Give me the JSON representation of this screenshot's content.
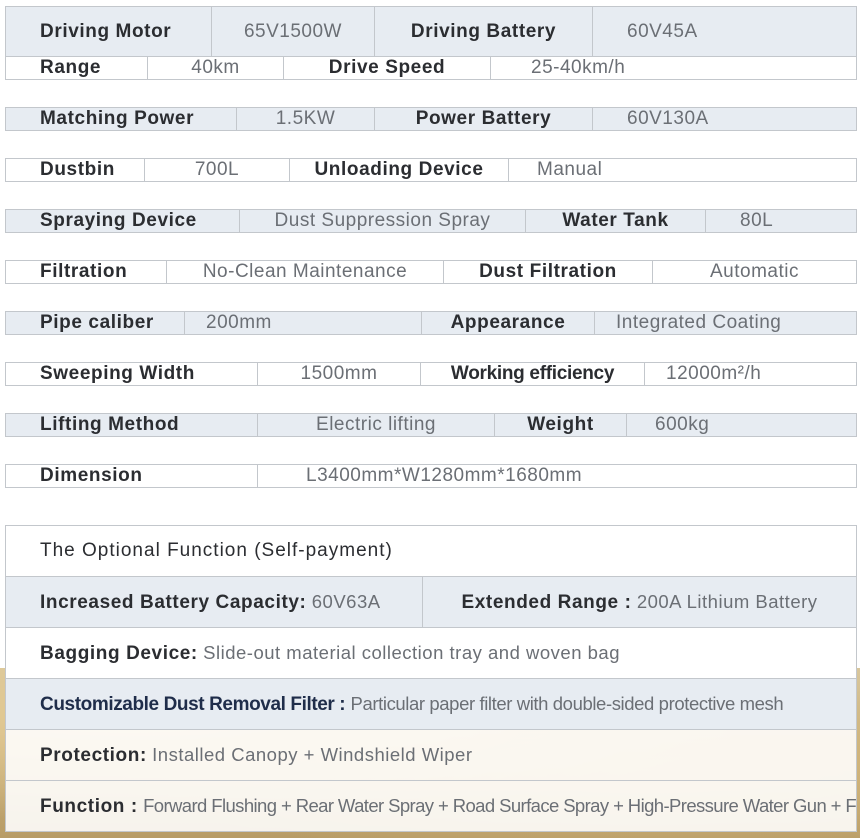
{
  "specs": [
    [
      {
        "label": "Driving Motor",
        "value": "65V1500W"
      },
      {
        "label": "Driving Battery",
        "value": "60V45A"
      }
    ],
    [
      {
        "label": "Range",
        "value": "40km"
      },
      {
        "label": "Drive Speed",
        "value": "25-40km/h"
      }
    ],
    [
      {
        "label": "Matching Power",
        "value": "1.5KW"
      },
      {
        "label": "Power Battery",
        "value": "60V130A"
      }
    ],
    [
      {
        "label": "Dustbin",
        "value": "700L"
      },
      {
        "label": "Unloading Device",
        "value": "Manual"
      }
    ],
    [
      {
        "label": "Spraying Device",
        "value": "Dust Suppression Spray"
      },
      {
        "label": "Water Tank",
        "value": "80L"
      }
    ],
    [
      {
        "label": "Filtration",
        "value": "No-Clean Maintenance"
      },
      {
        "label": "Dust Filtration",
        "value": "Automatic"
      }
    ],
    [
      {
        "label": "Pipe caliber",
        "value": "200mm"
      },
      {
        "label": "Appearance",
        "value": "Integrated Coating"
      }
    ],
    [
      {
        "label": "Sweeping Width",
        "value": "1500mm"
      },
      {
        "label": "Working efficiency",
        "value": "12000m²/h"
      }
    ],
    [
      {
        "label": "Lifting Method",
        "value": "Electric lifting"
      },
      {
        "label": "Weight",
        "value": "600kg"
      }
    ],
    [
      {
        "label": "Dimension",
        "value": "L3400mm*W1280mm*1680mm"
      }
    ]
  ],
  "optional": {
    "title": "The Optional Function (Self-payment)",
    "battery": {
      "label": "Increased Battery Capacity:",
      "value": "60V63A"
    },
    "range": {
      "label": "Extended Range :",
      "value": "200A Lithium Battery"
    },
    "bagging": {
      "label": "Bagging Device:",
      "value": "Slide-out material collection tray and woven bag"
    },
    "filter": {
      "label": "Customizable Dust Removal Filter :",
      "value": "Particular paper filter with double-sided protective mesh"
    },
    "protection": {
      "label": "Protection:",
      "value": "Installed Canopy + Windshield Wiper"
    },
    "function": {
      "label": "Function :",
      "value": "Forward Flushing + Rear Water Spray + Road Surface Spray + High-Pressure Water Gun + Floor Washer"
    }
  }
}
